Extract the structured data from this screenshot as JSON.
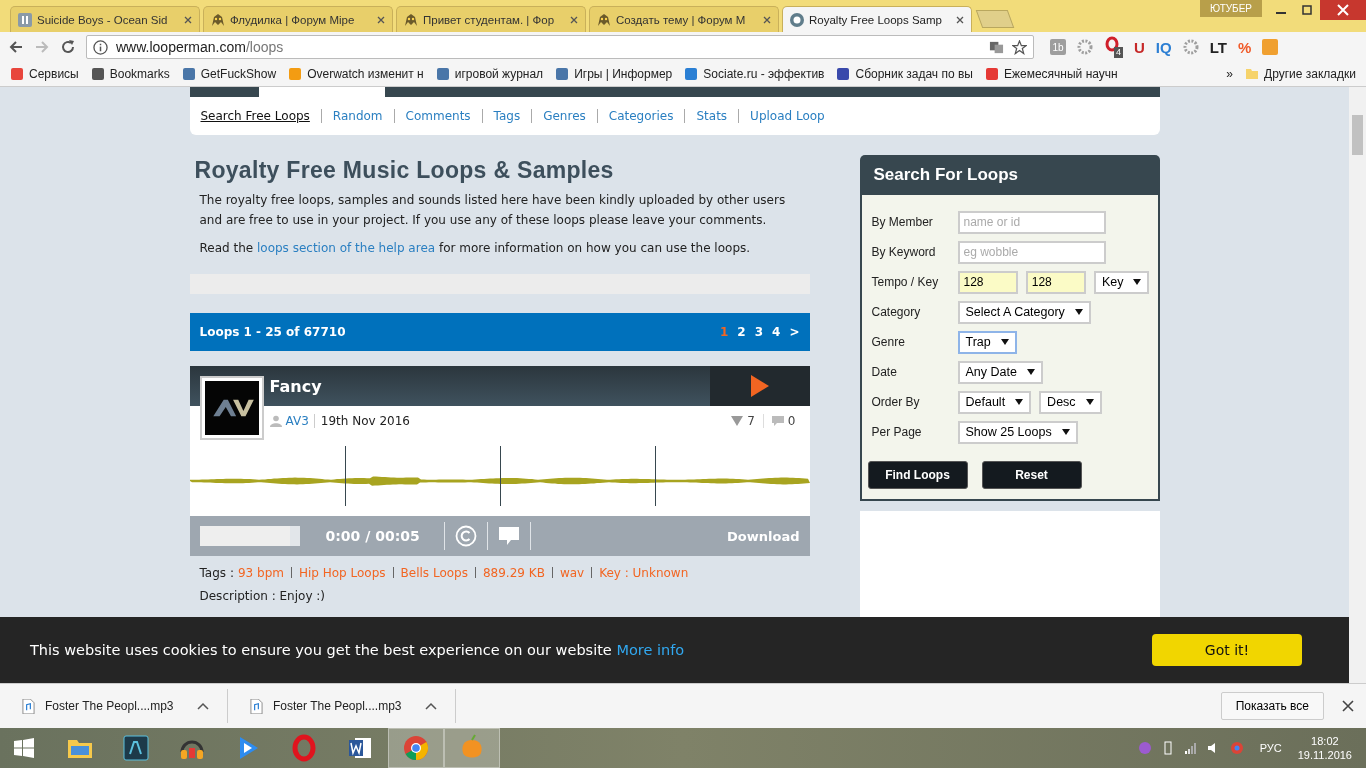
{
  "browser": {
    "tabs": [
      {
        "title": "Suicide Boys - Ocean Sid",
        "kind": "media",
        "selected": false
      },
      {
        "title": "Флудилка | Форум Mipe",
        "kind": "forum",
        "selected": false
      },
      {
        "title": "Привет студентам. | Фор",
        "kind": "forum",
        "selected": false
      },
      {
        "title": "Создать тему | Форум M",
        "kind": "forum",
        "selected": false
      },
      {
        "title": "Royalty Free Loops Samp",
        "kind": "site",
        "selected": true
      }
    ],
    "profile": "ЮТУБЕР",
    "address": {
      "host": "www.looperman.com",
      "path": "/loops"
    },
    "extensions": [
      {
        "kind": "tile",
        "label": "1b",
        "color": "#9e9e9e"
      },
      {
        "kind": "gear",
        "color": "#9e9e9e"
      },
      {
        "kind": "badge",
        "label": "4",
        "color": "#d0202b"
      },
      {
        "kind": "text",
        "label": "U",
        "color": "#c62828"
      },
      {
        "kind": "text",
        "label": "IQ",
        "color": "#2d7fd3"
      },
      {
        "kind": "gear",
        "color": "#9e9e9e"
      },
      {
        "kind": "text",
        "label": "LT",
        "color": "#222222"
      },
      {
        "kind": "text",
        "label": "%",
        "color": "#f05a28"
      },
      {
        "kind": "tile",
        "color": "#f0a030"
      }
    ],
    "bookmarks": [
      {
        "label": "Сервисы",
        "color": "#e8453c"
      },
      {
        "label": "Bookmarks",
        "color": "#555555"
      },
      {
        "label": "GetFuckShow",
        "color": "#4a76a8"
      },
      {
        "label": "Overwatch изменит н",
        "color": "#f39c12"
      },
      {
        "label": "игровой журнал",
        "color": "#4a76a8"
      },
      {
        "label": "Игры | Информер",
        "color": "#4a76a8"
      },
      {
        "label": "Sociate.ru - эффектив",
        "color": "#2a7fd4"
      },
      {
        "label": "Сборник задач по вы",
        "color": "#3949ab"
      },
      {
        "label": "Ежемесячный научн",
        "color": "#e53935"
      }
    ],
    "bookmarks_more": "»",
    "other_bookmarks": "Другие закладки"
  },
  "site": {
    "subnav": [
      {
        "label": "Search Free Loops",
        "selected": true
      },
      {
        "label": "Random",
        "selected": false
      },
      {
        "label": "Comments",
        "selected": false
      },
      {
        "label": "Tags",
        "selected": false
      },
      {
        "label": "Genres",
        "selected": false
      },
      {
        "label": "Categories",
        "selected": false
      },
      {
        "label": "Stats",
        "selected": false
      },
      {
        "label": "Upload Loop",
        "selected": false
      }
    ],
    "heading": "Royalty Free Music Loops & Samples",
    "intro": "The royalty free loops, samples and sounds listed here have been kindly uploaded by other users and are free to use in your project. If you use any of these loops please leave your comments.",
    "help_before": "Read the",
    "help_link": "loops section of the help area",
    "help_after": "for more information on how you can use the loops.",
    "pager": {
      "summary": "Loops 1 - 25 of 67710",
      "pages": [
        {
          "label": "1",
          "selected": true
        },
        {
          "label": "2",
          "selected": false
        },
        {
          "label": "3",
          "selected": false
        },
        {
          "label": "4",
          "selected": false
        },
        {
          "label": ">",
          "selected": false
        }
      ]
    },
    "loop": {
      "title": "Fancy",
      "author": "AV3",
      "date": "19th Nov 2016",
      "downloads": "7",
      "comments": "0",
      "level": 0.9,
      "time": "0:00 / 00:05",
      "download": "Download",
      "tags_label": "Tags :",
      "tags": [
        "93 bpm",
        "Hip Hop Loops",
        "Bells Loops",
        "889.29 KB",
        "wav",
        "Key : Unknown"
      ],
      "description": "Description : Enjoy :)"
    },
    "search": {
      "title": "Search For Loops",
      "rows": [
        {
          "label": "By Member",
          "controls": [
            {
              "kind": "input",
              "placeholder": "name or id",
              "focused": false
            }
          ]
        },
        {
          "label": "By Keyword",
          "controls": [
            {
              "kind": "input",
              "placeholder": "eg wobble",
              "focused": false
            }
          ]
        },
        {
          "label": "Tempo / Key",
          "controls": [
            {
              "kind": "input",
              "value": "128",
              "focused": false
            },
            {
              "kind": "input",
              "value": "128",
              "focused": false
            },
            {
              "kind": "select",
              "value": "Key",
              "focused": false
            }
          ]
        },
        {
          "label": "Category",
          "controls": [
            {
              "kind": "select",
              "value": "Select A Category",
              "focused": false
            }
          ]
        },
        {
          "label": "Genre",
          "controls": [
            {
              "kind": "select",
              "value": "Trap",
              "focused": true
            }
          ]
        },
        {
          "label": "Date",
          "controls": [
            {
              "kind": "select",
              "value": "Any Date",
              "focused": false
            }
          ]
        },
        {
          "label": "Order By",
          "controls": [
            {
              "kind": "select",
              "value": "Default",
              "focused": false
            },
            {
              "kind": "select",
              "value": "Desc",
              "focused": false
            }
          ]
        },
        {
          "label": "Per Page",
          "controls": [
            {
              "kind": "select",
              "value": "Show 25 Loops",
              "focused": false
            }
          ]
        }
      ],
      "buttons": [
        "Find Loops",
        "Reset"
      ]
    },
    "cookie": {
      "text": "This website uses cookies to ensure you get the best experience on our website",
      "link": "More info",
      "button": "Got it!"
    }
  },
  "downloads": {
    "items": [
      {
        "name": "Foster The Peopl....mp3"
      },
      {
        "name": "Foster The Peopl....mp3"
      }
    ],
    "show_all": "Показать все"
  },
  "taskbar": {
    "apps": [
      {
        "kind": "explorer",
        "active": false
      },
      {
        "kind": "audition",
        "active": false
      },
      {
        "kind": "audio",
        "active": false
      },
      {
        "kind": "player",
        "active": false
      },
      {
        "kind": "opera",
        "active": false
      },
      {
        "kind": "word",
        "active": false
      },
      {
        "kind": "chrome",
        "active": true
      },
      {
        "kind": "fruity",
        "active": true
      }
    ],
    "language": "РУС",
    "time": "18:02",
    "date": "19.11.2016"
  }
}
